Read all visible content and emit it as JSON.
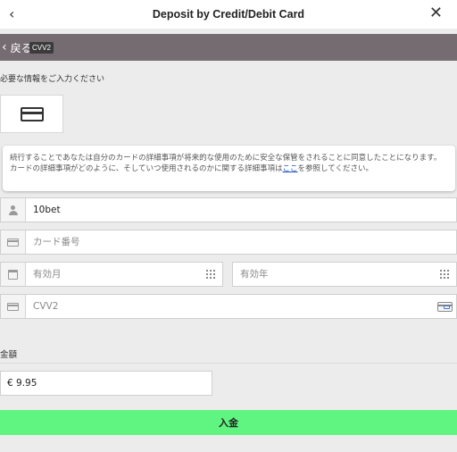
{
  "header": {
    "back_icon": "chevron-left-icon",
    "title": "Deposit by Credit/Debit Card",
    "close_icon": "close-icon"
  },
  "subbar": {
    "back_label": "戻る",
    "tooltip": "CVV2",
    "background": "#756c72"
  },
  "form": {
    "required_text": "必要な情報をご入力ください",
    "notice_before_link": "続行することであなたは自分のカードの詳細事項が将来的な使用のために安全な保管をされることに同意したことになります。カードの詳細事項がどのように、そしていつ使用されるのかに関する詳細事項は",
    "notice_link": "ここ",
    "notice_after_link": "を参照してください。",
    "cardholder_value": "10bet",
    "card_number_placeholder": "カード番号",
    "expiry_month_placeholder": "有効月",
    "expiry_year_placeholder": "有効年",
    "cvv_placeholder": "CVV2",
    "amount_label": "金額",
    "amount_value": "€ 9.95",
    "deposit_label": "入金",
    "deposit_color": "#5ff580"
  }
}
